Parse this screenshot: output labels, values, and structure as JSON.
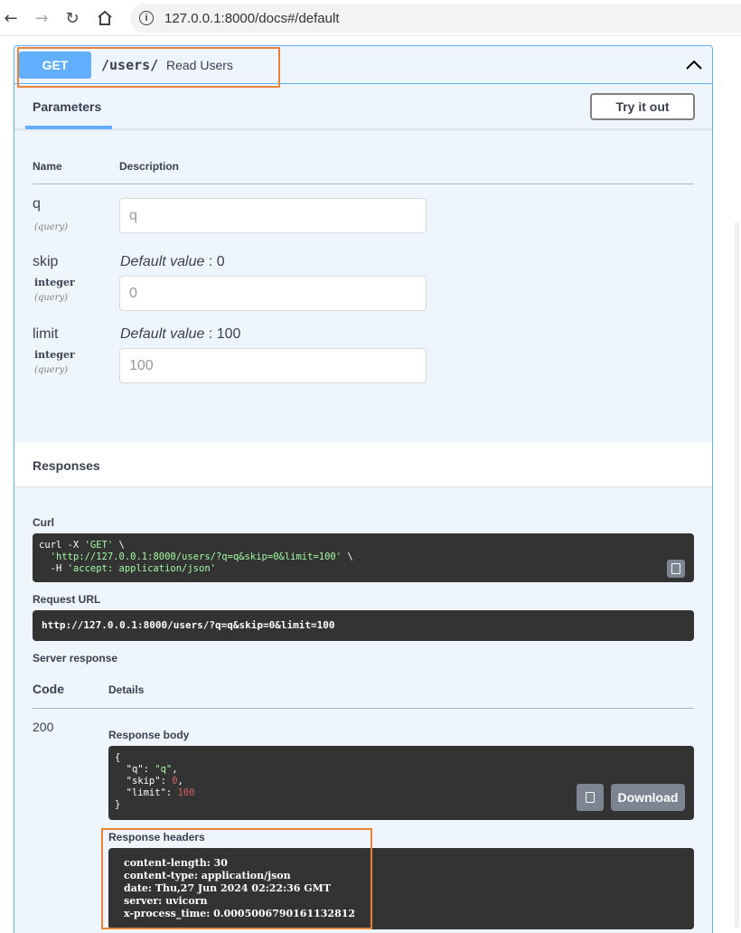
{
  "browser": {
    "url": "127.0.0.1:8000/docs#/default"
  },
  "operation": {
    "method": "GET",
    "path": "/users/",
    "summary": "Read Users"
  },
  "parameters": {
    "tab_title": "Parameters",
    "try_label": "Try it out",
    "col_name": "Name",
    "col_description": "Description",
    "items": [
      {
        "name": "q",
        "type": "",
        "in": "(query)",
        "default_label": "",
        "default_value": "",
        "placeholder": "q"
      },
      {
        "name": "skip",
        "type": "integer",
        "in": "(query)",
        "default_label": "Default value",
        "default_value": " : 0",
        "placeholder": "0"
      },
      {
        "name": "limit",
        "type": "integer",
        "in": "(query)",
        "default_label": "Default value",
        "default_value": " : 100",
        "placeholder": "100"
      }
    ]
  },
  "responses": {
    "title": "Responses",
    "curl_label": "Curl",
    "curl_lines": [
      "curl -X ",
      "'GET'",
      " \\",
      "  ",
      "'http://127.0.0.1:8000/users/?q=q&skip=0&limit=100'",
      " \\",
      "  -H ",
      "'accept: application/json'"
    ],
    "request_url_label": "Request URL",
    "request_url": "http://127.0.0.1:8000/users/?q=q&skip=0&limit=100",
    "server_response_label": "Server response",
    "code_head": "Code",
    "details_head": "Details",
    "code": "200",
    "body_label": "Response body",
    "body": {
      "open": "{",
      "q_key": "  \"q\": ",
      "q_val": "\"q\"",
      "skip_key": "  \"skip\": ",
      "skip_val": "0",
      "limit_key": "  \"limit\": ",
      "limit_val": "100",
      "close": "}"
    },
    "download_label": "Download",
    "headers_label": "Response headers",
    "headers": [
      "content-length: 30",
      "content-type: application/json",
      "date: Thu,27 Jun 2024 02:22:36 GMT",
      "server: uvicorn",
      "x-process_time: 0.0005006790161132812"
    ]
  },
  "colors": {
    "get_accent": "#61affe",
    "highlight": "#e8833a",
    "code_bg": "#333333"
  }
}
